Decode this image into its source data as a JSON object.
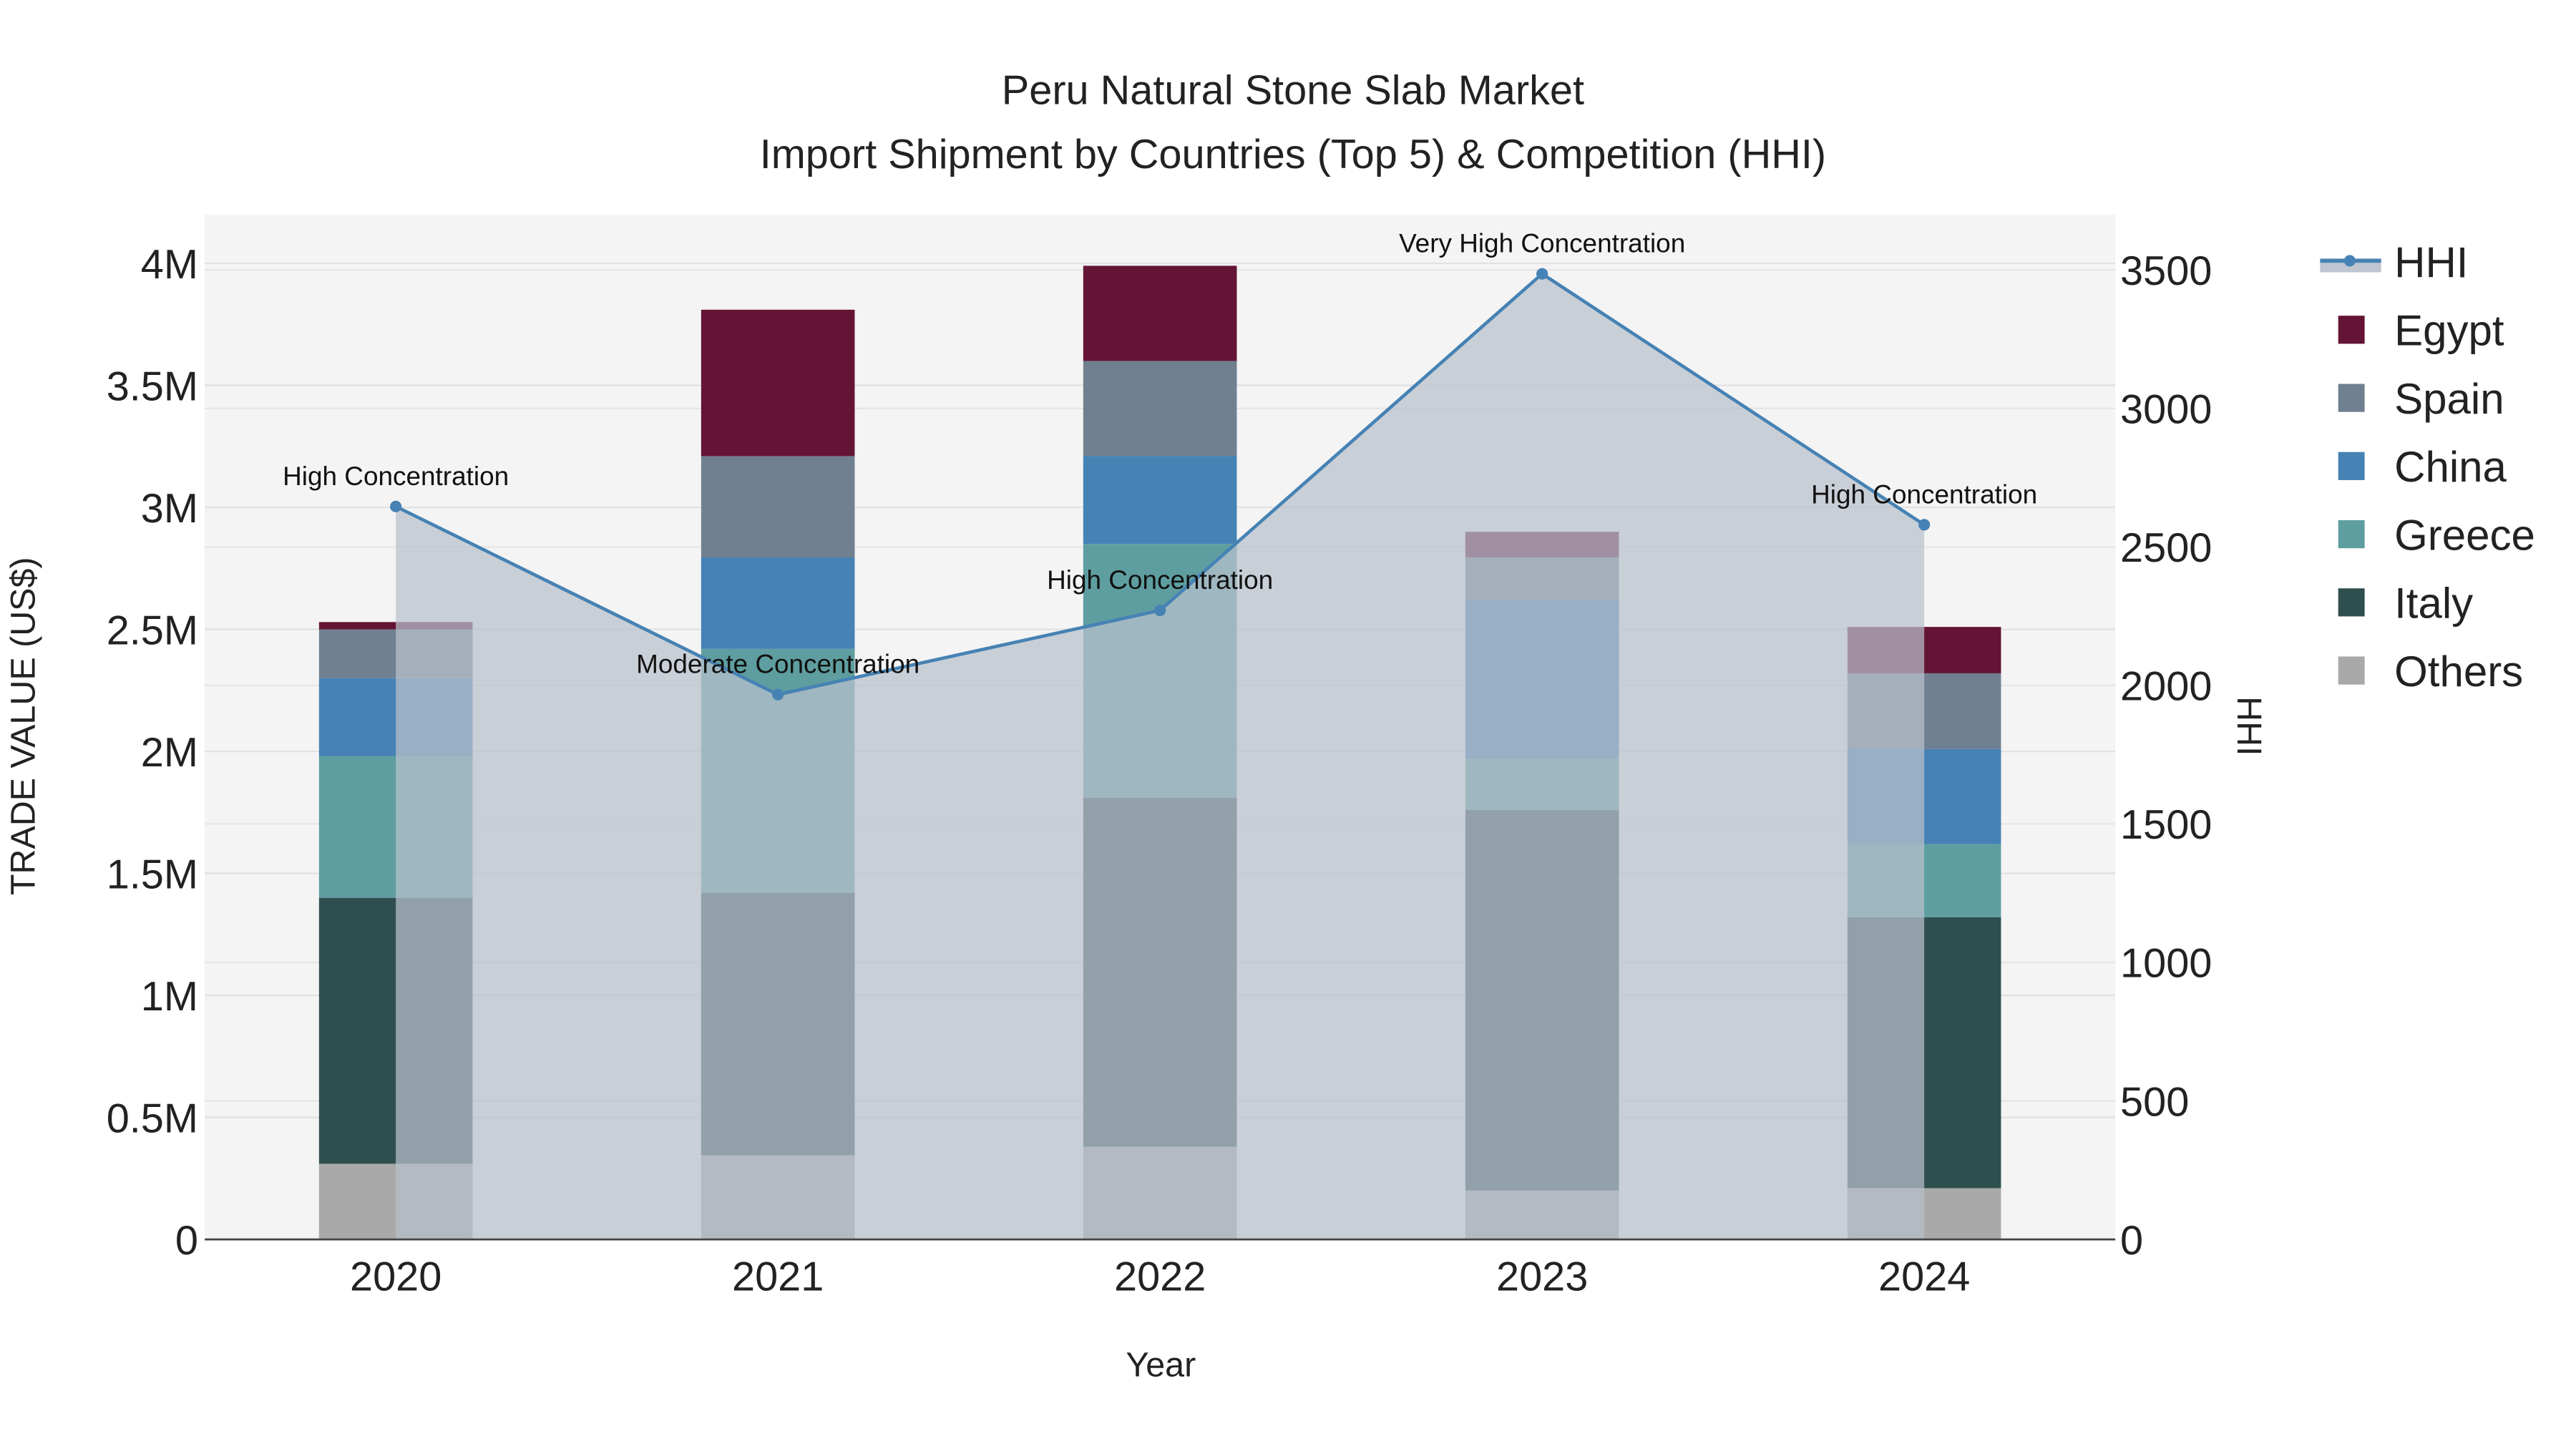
{
  "chart_data": {
    "type": "bar",
    "title": "Peru Natural Stone Slab Market",
    "subtitle": "Import Shipment by Countries (Top 5) & Competition (HHI)",
    "xlabel": "Year",
    "ylabel": "TRADE VALUE (US$)",
    "y2label": "HHI",
    "categories": [
      "2020",
      "2021",
      "2022",
      "2023",
      "2024"
    ],
    "ylim": [
      0,
      4200000
    ],
    "y2lim": [
      0,
      3700
    ],
    "yticks": [
      0,
      500000,
      1000000,
      1500000,
      2000000,
      2500000,
      3000000,
      3500000,
      4000000
    ],
    "ytick_labels": [
      "0",
      "0.5M",
      "1M",
      "1.5M",
      "2M",
      "2.5M",
      "3M",
      "3.5M",
      "4M"
    ],
    "y2ticks": [
      0,
      500,
      1000,
      1500,
      2000,
      2500,
      3000,
      3500
    ],
    "y2tick_labels": [
      "0",
      "500",
      "1000",
      "1500",
      "2000",
      "2500",
      "3000",
      "3500"
    ],
    "grid": true,
    "legend_position": "right",
    "stacked": true,
    "series": [
      {
        "name": "Others",
        "color": "#A9A9A9",
        "values": [
          310000,
          345000,
          380000,
          200000,
          210000
        ]
      },
      {
        "name": "Italy",
        "color": "#2F4F4F",
        "values": [
          1090000,
          1075000,
          1430000,
          1560000,
          1110000
        ]
      },
      {
        "name": "Greece",
        "color": "#5F9EA0",
        "values": [
          580000,
          1000000,
          1040000,
          210000,
          300000
        ]
      },
      {
        "name": "China",
        "color": "#4682B4",
        "values": [
          320000,
          375000,
          360000,
          650000,
          390000
        ]
      },
      {
        "name": "Spain",
        "color": "#708090",
        "values": [
          200000,
          415000,
          390000,
          175000,
          310000
        ]
      },
      {
        "name": "Egypt",
        "color": "#641434",
        "values": [
          30000,
          600000,
          390000,
          105000,
          190000
        ]
      }
    ],
    "line": {
      "name": "HHI",
      "color": "#4682B4",
      "values": [
        2646,
        1967,
        2271,
        3486,
        2580
      ],
      "annotations": [
        "High Concentration",
        "Moderate Concentration",
        "High Concentration",
        "Very High Concentration",
        "High Concentration"
      ]
    },
    "legend_order": [
      "HHI",
      "Egypt",
      "Spain",
      "China",
      "Greece",
      "Italy",
      "Others"
    ]
  }
}
